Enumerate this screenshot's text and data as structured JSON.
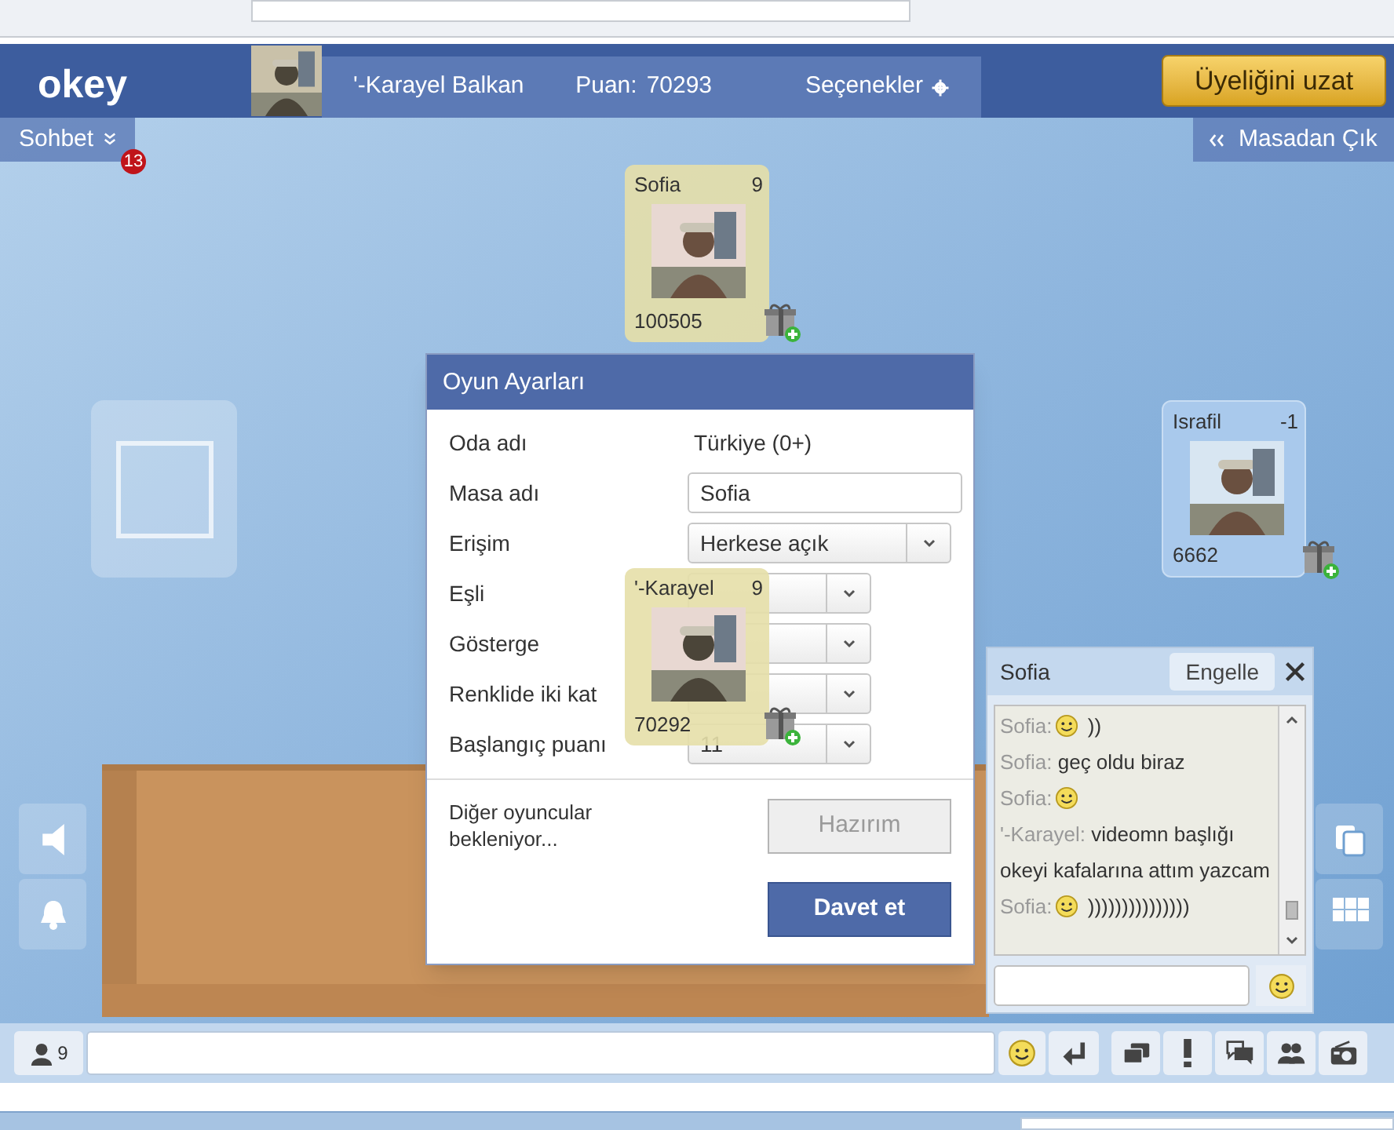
{
  "header": {
    "logo": "okey",
    "player_name": "'-Karayel Balkan",
    "score_label": "Puan:",
    "score": "70293",
    "options": "Seçenekler",
    "extend_button": "Üyeliğini uzat"
  },
  "subbar": {
    "chat_toggle": "Sohbet",
    "chat_badge": "13",
    "leave_button": "Masadan Çık"
  },
  "seats": [
    {
      "kind": "player",
      "name": "Sofia",
      "rank": "9",
      "score": "100505",
      "active": true
    },
    {
      "kind": "player",
      "name": "Israfil",
      "rank": "-1",
      "score": "6662",
      "active": false
    },
    {
      "kind": "player",
      "name": "'-Karayel",
      "rank": "9",
      "score": "70292",
      "active": true
    },
    {
      "kind": "empty"
    }
  ],
  "dialog": {
    "title": "Oyun Ayarları",
    "rows": [
      {
        "kind": "text",
        "label": "Oda adı",
        "value": "Türkiye (0+)"
      },
      {
        "kind": "input",
        "label": "Masa adı",
        "value": "Sofia"
      },
      {
        "kind": "select_wide",
        "label": "Erişim",
        "value": "Herkese açık"
      },
      {
        "kind": "select",
        "label": "Eşli"
      },
      {
        "kind": "select",
        "label": "Gösterge"
      },
      {
        "kind": "select",
        "label": "Renklide iki kat"
      },
      {
        "kind": "select",
        "label": "Başlangıç puanı",
        "value": "11"
      }
    ],
    "status": "Diğer oyuncular bekleniyor...",
    "buttons": [
      {
        "label": "Hazırım",
        "disabled": true
      },
      {
        "label": "Davet et",
        "disabled": false
      }
    ]
  },
  "chat": {
    "title": "Sofia",
    "block_button": "Engelle",
    "messages": [
      {
        "sender": "Sofia:",
        "emoji": true,
        "text": "))"
      },
      {
        "sender": "Sofia:",
        "emoji": false,
        "text": "geç oldu biraz"
      },
      {
        "sender": "Sofia:",
        "emoji": true
      },
      {
        "sender": "'-Karayel:",
        "emoji": false,
        "text": "videomn başlığı okeyi kafalarına attım yazcam"
      },
      {
        "sender": "Sofia:",
        "emoji": true,
        "text": ")))))))))))))))"
      }
    ]
  },
  "bottom_bar": {
    "online_count": "9"
  }
}
